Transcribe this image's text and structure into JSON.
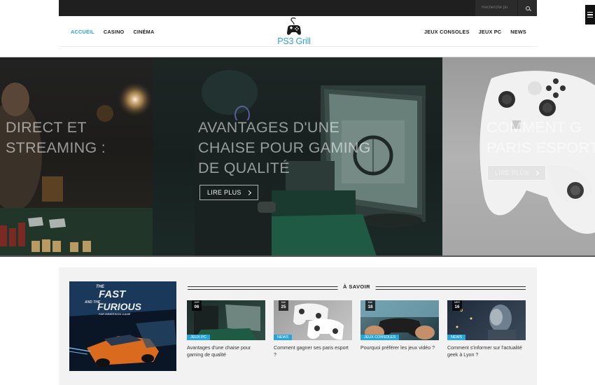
{
  "search": {
    "placeholder": "Recherche pu"
  },
  "nav": {
    "left": [
      "ACCUEIL",
      "CASINO",
      "CINÉMA"
    ],
    "right": [
      "JEUX CONSOLES",
      "JEUX PC",
      "NEWS"
    ],
    "active": "ACCUEIL"
  },
  "logo": {
    "text": "PS3 Grill"
  },
  "slider": {
    "slides": [
      {
        "title_lines": [
          "DIRECT ET",
          "STREAMING :"
        ]
      },
      {
        "title_lines": [
          "AVANTAGES D'UNE",
          "CHAISE POUR GAMING",
          "DE QUALITÉ"
        ],
        "button": "LIRE PLUS"
      },
      {
        "title_lines": [
          "COMMENT G",
          "PARIS ESPORT"
        ],
        "button": "LIRE PLUS"
      }
    ]
  },
  "block": {
    "title": "À SAVOIR",
    "feature_image_text": {
      "line1": "THE",
      "line2": "FAST",
      "line3": "AND THE",
      "line4": "FURIOUS",
      "line5": "FAR IMMERSION GAME"
    },
    "cards": [
      {
        "month": "AVR",
        "day": "06",
        "category": "JEUX PC",
        "title": "Avantages d'une chaise pour gaming de qualité"
      },
      {
        "month": "MAI",
        "day": "25",
        "category": "NEWS",
        "title": "Comment gagner ses paris esport ?"
      },
      {
        "month": "MAI",
        "day": "18",
        "category": "JEUX CONSOLES",
        "title": "Pourquoi préférer les jeux vidéo ?"
      },
      {
        "month": "MER",
        "day": "16",
        "category": "NEWS",
        "title": "Comment s'informer sur l'actualité geek à Lyon ?"
      }
    ]
  },
  "colors": {
    "accent": "#2ba3d6",
    "topbar": "#1f1f1f",
    "section_bg": "#f2f2f2"
  }
}
